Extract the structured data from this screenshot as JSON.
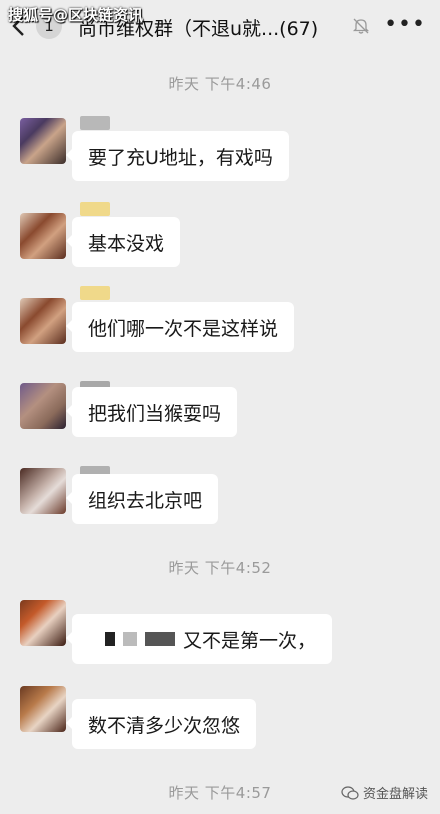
{
  "watermark_top": "搜狐号@区块链资讯",
  "header": {
    "back_icon": "chevron-left-icon",
    "unread_count": "1",
    "title": "尚币维权群（不退u就...(67)",
    "mute_icon": "bell-muted-icon",
    "more_icon": "more-icon",
    "more_label": "•••"
  },
  "timestamps": [
    "昨天 下午4:46",
    "昨天 下午4:52",
    "昨天 下午4:57"
  ],
  "messages": [
    {
      "text": "要了充U地址，有戏吗"
    },
    {
      "text": "基本没戏"
    },
    {
      "text": "他们哪一次不是这样说"
    },
    {
      "text": "把我们当猴耍吗"
    },
    {
      "text": "组织去北京吧"
    },
    {
      "text": "又不是第一次，"
    },
    {
      "text": "数不清多少次忽悠"
    }
  ],
  "watermark_bottom": "资金盘解读",
  "colors": {
    "background": "#ededed",
    "bubble": "#ffffff",
    "time_text": "#9a9a9a"
  }
}
